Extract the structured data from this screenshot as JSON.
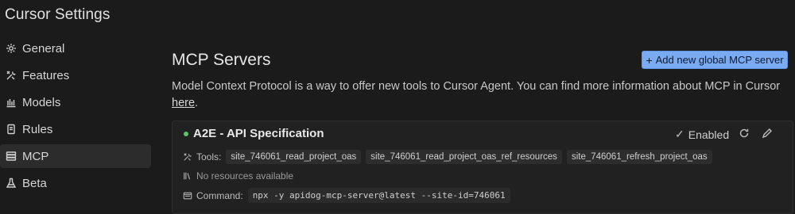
{
  "app": {
    "title": "Cursor Settings"
  },
  "sidebar": {
    "items": [
      {
        "label": "General",
        "icon": "gear-icon",
        "active": false
      },
      {
        "label": "Features",
        "icon": "tools-icon",
        "active": false
      },
      {
        "label": "Models",
        "icon": "bar-chart-icon",
        "active": false
      },
      {
        "label": "Rules",
        "icon": "document-icon",
        "active": false
      },
      {
        "label": "MCP",
        "icon": "server-icon",
        "active": true
      },
      {
        "label": "Beta",
        "icon": "flask-icon",
        "active": false
      }
    ]
  },
  "main": {
    "title": "MCP Servers",
    "add_button_label": "Add new global MCP server",
    "description_text": "Model Context Protocol is a way to offer new tools to Cursor Agent. You can find more information about MCP in Cursor ",
    "description_link": "here",
    "description_end": "."
  },
  "server": {
    "name": "A2E - API Specification",
    "status_color": "#5cc46b",
    "status_label": "Enabled",
    "tools_label": "Tools:",
    "tools": [
      "site_746061_read_project_oas",
      "site_746061_read_project_oas_ref_resources",
      "site_746061_refresh_project_oas"
    ],
    "resources_text": "No resources available",
    "command_label": "Command:",
    "command": "npx -y apidog-mcp-server@latest --site-id=746061"
  },
  "colors": {
    "accent": "#79aaf2",
    "background": "#1b1b1b"
  }
}
